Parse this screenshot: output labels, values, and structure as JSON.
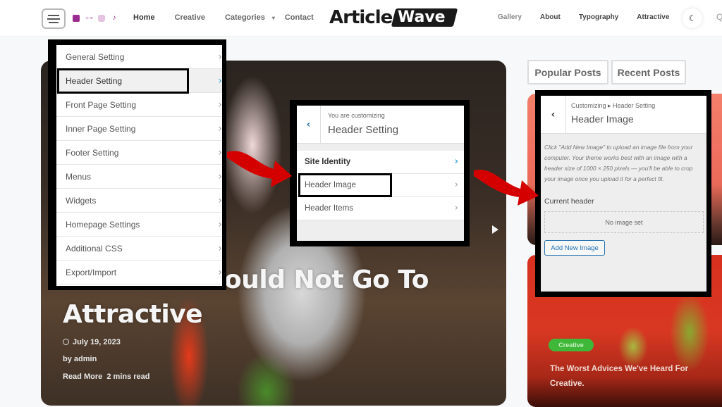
{
  "site": {
    "logo_part1": "Article",
    "logo_part2": "Wave"
  },
  "nav": {
    "left_links": [
      "Home",
      "Creative",
      "Categories",
      "Contact"
    ],
    "right_links": [
      "Gallery",
      "About",
      "Typography",
      "Attractive"
    ],
    "categories_caret": "▾",
    "social_icons": [
      "facebook-icon",
      "key-icon",
      "instagram-icon",
      "tiktok-icon"
    ],
    "tiktok_glyph": "♪",
    "key_glyph": "⊶",
    "theme_toggle_glyph": "☾",
    "search_glyph": "Q"
  },
  "hero": {
    "title_line1": "ould Not Go To",
    "title_line2": "Attractive",
    "date": "July 19, 2023",
    "author": "by admin",
    "read_more": "Read More",
    "read_time": "2 mins read",
    "next_icon": "play-next-icon"
  },
  "sidebar": {
    "tabs": [
      "Popular Posts",
      "Recent Posts"
    ],
    "card": {
      "category": "Creative",
      "title": "The Worst Advices We've Heard For Creative."
    }
  },
  "panel_customizer_menu": {
    "items": [
      {
        "label": "General Setting",
        "active": false
      },
      {
        "label": "Header Setting",
        "active": true
      },
      {
        "label": "Front Page Setting",
        "active": false
      },
      {
        "label": "Inner Page Setting",
        "active": false
      },
      {
        "label": "Footer Setting",
        "active": false
      },
      {
        "label": "Menus",
        "active": false
      },
      {
        "label": "Widgets",
        "active": false
      },
      {
        "label": "Homepage Settings",
        "active": false
      },
      {
        "label": "Additional CSS",
        "active": false
      },
      {
        "label": "Export/Import",
        "active": false
      }
    ],
    "chevron": "›"
  },
  "panel_header_setting": {
    "subtitle": "You are customizing",
    "title": "Header Setting",
    "back_glyph": "‹",
    "items": [
      {
        "label": "Site Identity"
      },
      {
        "label": "Header Image"
      },
      {
        "label": "Header Items"
      }
    ],
    "chevron": "›"
  },
  "panel_header_image": {
    "breadcrumb": "Customizing ▸ Header Setting",
    "title": "Header Image",
    "back_glyph": "‹",
    "description": "Click \"Add New Image\" to upload an image file from your computer. Your theme works best with an image with a header size of 1000 × 250 pixels — you'll be able to crop your image once you upload it for a perfect fit.",
    "current_header_label": "Current header",
    "placeholder": "No image set",
    "add_button": "Add New Image"
  },
  "colors": {
    "highlight_border": "#000000",
    "arrow": "#d40000",
    "wp_blue": "#2271b1",
    "chevron_active": "#2ea2cc",
    "badge_green": "#3fb83a"
  }
}
